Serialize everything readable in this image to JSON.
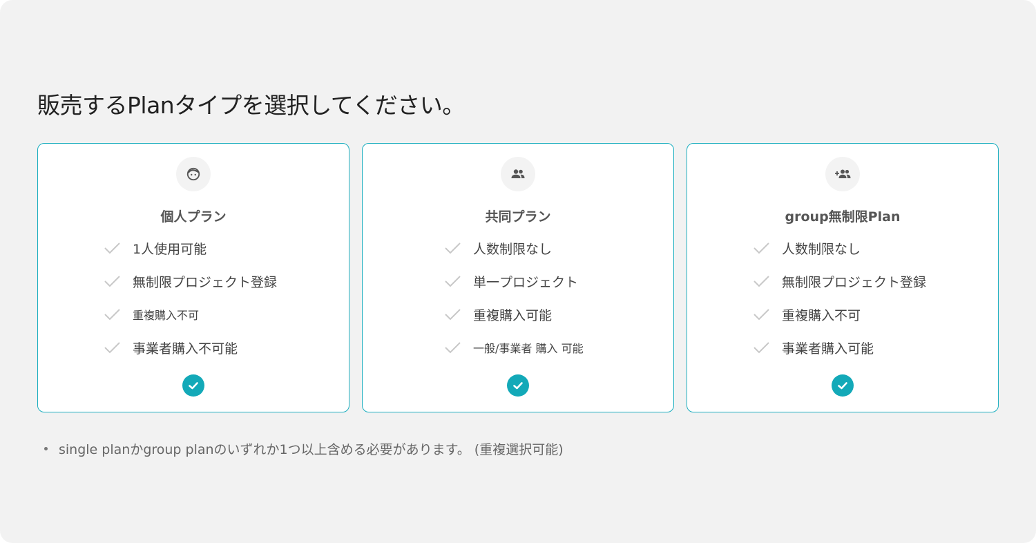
{
  "page": {
    "title": "販売するPlanタイプを選択してください。",
    "note": "single planかgroup planのいずれか1つ以上含める必要があります。 (重複選択可能)"
  },
  "colors": {
    "accent": "#13a9b8",
    "card_border": "#1aaebf",
    "background": "#f2f2f2",
    "check_muted": "#c8c8c8"
  },
  "plans": [
    {
      "title": "個人プラン",
      "icon": "face-icon",
      "selected": true,
      "features": [
        "1人使用可能",
        "無制限プロジェクト登録",
        "重複購入不可",
        "事業者購入不可能"
      ]
    },
    {
      "title": "共同プラン",
      "icon": "people-icon",
      "selected": true,
      "features": [
        "人数制限なし",
        "単一プロジェクト",
        "重複購入可能",
        "一般/事業者 購入 可能"
      ]
    },
    {
      "title": "group無制限Plan",
      "icon": "group-add-icon",
      "selected": true,
      "features": [
        "人数制限なし",
        "無制限プロジェクト登録",
        "重複購入不可",
        "事業者購入可能"
      ]
    }
  ]
}
